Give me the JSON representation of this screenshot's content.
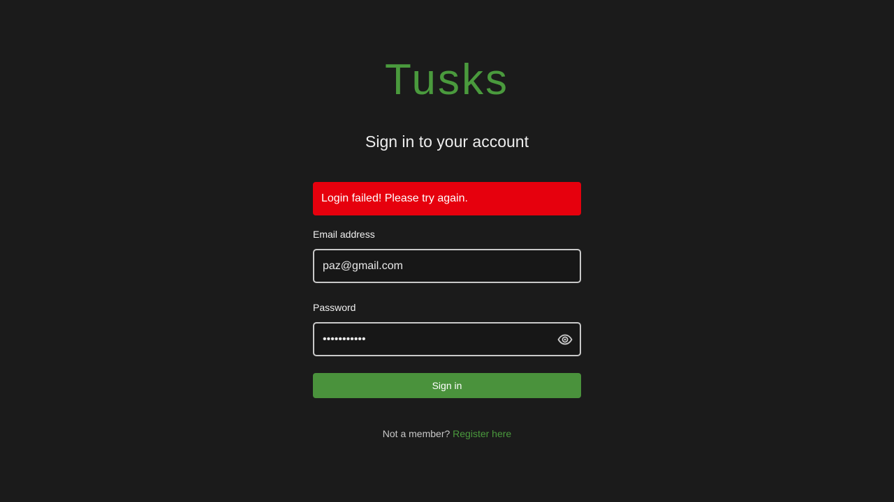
{
  "app": {
    "logo_text": "Tusks",
    "brand_color": "#4a9a3d"
  },
  "heading": "Sign in to your account",
  "alert": {
    "message": "Login failed! Please try again.",
    "color": "#e6000d"
  },
  "email": {
    "label": "Email address",
    "value": "paz@gmail.com"
  },
  "password": {
    "label": "Password",
    "value": "passwordxxx",
    "toggle_icon": "eye-icon"
  },
  "signin_button": {
    "label": "Sign in"
  },
  "footer": {
    "prompt": "Not a member?",
    "link_label": "Register here"
  }
}
